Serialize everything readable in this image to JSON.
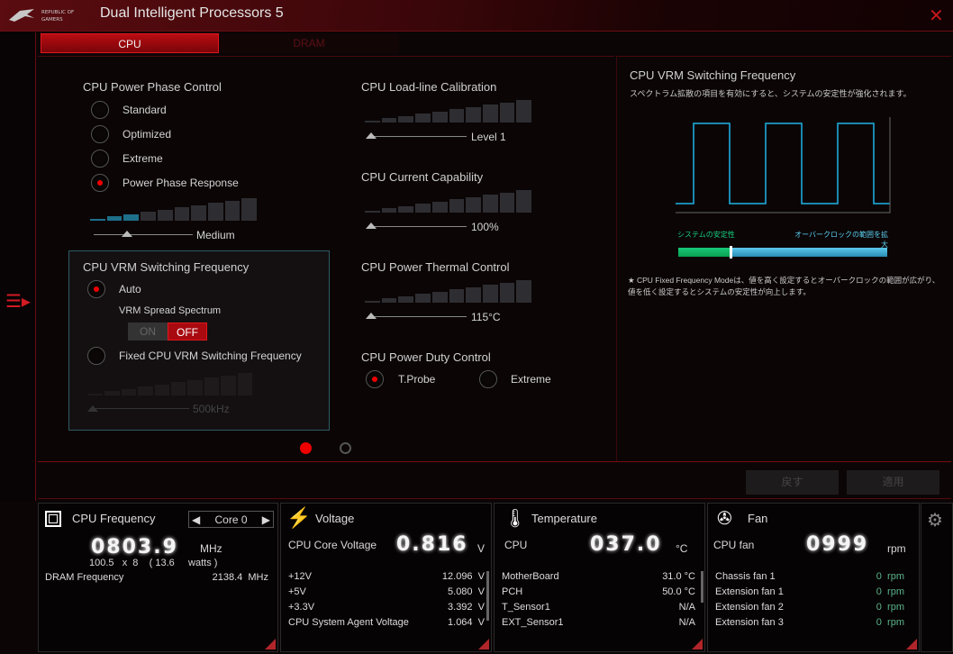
{
  "app": {
    "title": "Dual Intelligent Processors 5",
    "logo_text": "REPUBLIC OF GAMERS"
  },
  "tabs": [
    {
      "label": "CPU"
    },
    {
      "label": "DRAM"
    }
  ],
  "phase": {
    "title": "CPU Power Phase Control",
    "options": [
      "Standard",
      "Optimized",
      "Extreme",
      "Power Phase Response"
    ],
    "selected": 3,
    "level_label": "Medium",
    "filled": 3
  },
  "vrm": {
    "title": "CPU VRM Switching Frequency",
    "auto": "Auto",
    "spread_label": "VRM Spread Spectrum",
    "on": "ON",
    "off": "OFF",
    "fixed": "Fixed CPU VRM Switching Frequency",
    "level_label": "500kHz"
  },
  "llc": {
    "title": "CPU Load-line Calibration",
    "value": "Level 1"
  },
  "current": {
    "title": "CPU Current Capability",
    "value": "100%"
  },
  "thermal": {
    "title": "CPU Power Thermal Control",
    "value": "115°C"
  },
  "duty": {
    "title": "CPU Power Duty Control",
    "options": [
      "T.Probe",
      "Extreme"
    ]
  },
  "help": {
    "title": "CPU VRM Switching Frequency",
    "desc": "スペクトラム拡散の項目を有効にすると、システムの安定性が強化されます。",
    "left": "システムの安定性",
    "right": "オーバークロックの範囲を拡大",
    "note": "CPU Fixed Frequency Modeは、値を高く設定するとオーバークロックの範囲が広がり、値を低く設定するとシステムの安定性が向上します。",
    "colors": {
      "wave": "#1eb4e6",
      "stable": "#10b060",
      "oc": "#3aa4d0"
    }
  },
  "buttons": {
    "undo": "戻す",
    "apply": "適用"
  },
  "cpu_freq": {
    "title": "CPU Frequency",
    "core": "Core 0",
    "value": "0803.9",
    "unit": "MHz",
    "detail": "100.5   x  8    ( 13.6     watts )",
    "dram_label": "DRAM Frequency",
    "dram_value": "2138.4  MHz"
  },
  "voltage": {
    "title": "Voltage",
    "main_label": "CPU Core Voltage",
    "main_value": "0.816",
    "unit": "V",
    "rows": [
      [
        "+12V",
        "12.096  V"
      ],
      [
        "+5V",
        "5.080  V"
      ],
      [
        "+3.3V",
        "3.392  V"
      ],
      [
        "CPU System Agent Voltage",
        "1.064  V"
      ]
    ]
  },
  "temp": {
    "title": "Temperature",
    "main_label": "CPU",
    "main_value": "037.0",
    "unit": "°C",
    "rows": [
      [
        "MotherBoard",
        "31.0 °C"
      ],
      [
        "PCH",
        "50.0 °C"
      ],
      [
        "T_Sensor1",
        "N/A"
      ],
      [
        "EXT_Sensor1",
        "N/A"
      ]
    ]
  },
  "fan": {
    "title": "Fan",
    "main_label": "CPU fan",
    "main_value": "0999",
    "unit": "rpm",
    "rows": [
      [
        "Chassis fan 1",
        "0",
        "rpm"
      ],
      [
        "Extension fan 1",
        "0",
        "rpm"
      ],
      [
        "Extension fan 2",
        "0",
        "rpm"
      ],
      [
        "Extension fan 3",
        "0",
        "rpm"
      ]
    ]
  }
}
